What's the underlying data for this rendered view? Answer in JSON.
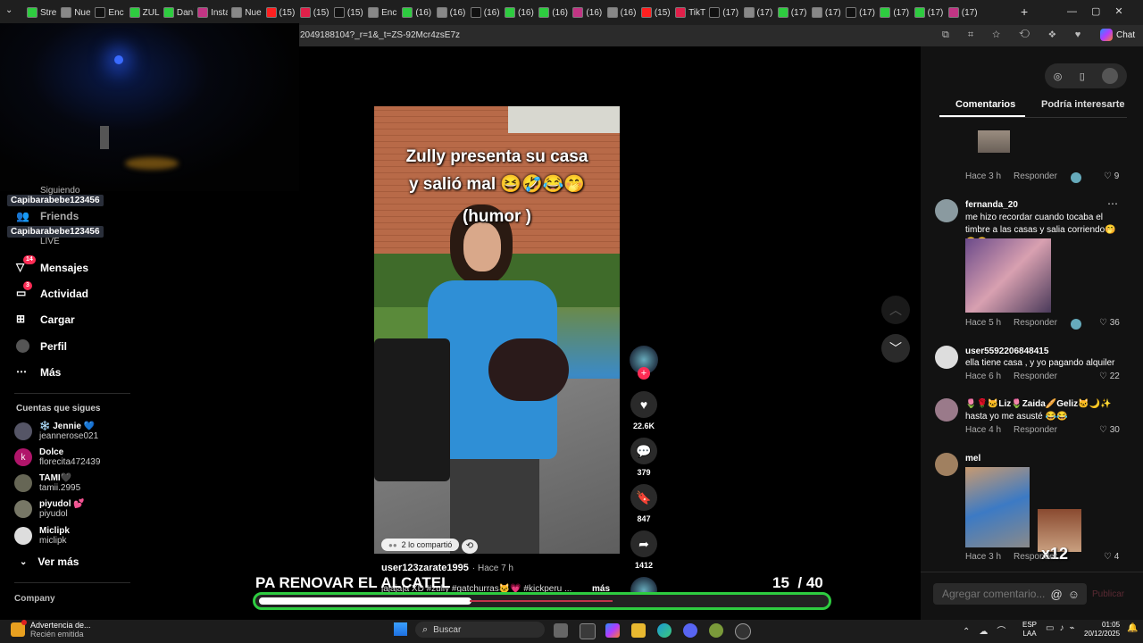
{
  "browser": {
    "tabs": [
      "Stre",
      "Nue",
      "Enc",
      "ZULL",
      "Dani",
      "Insta",
      "Nue",
      "(15)",
      "(15)",
      "(15)",
      "Enc",
      "(16)",
      "(16)",
      "(16)",
      "(16)",
      "(16)",
      "(16)",
      "(16)",
      "(15)",
      "TikT",
      "(17)",
      "(17)",
      "(17)",
      "(17)",
      "(17)",
      "(17)",
      "(17)",
      "(17)"
    ],
    "new_tab": "+",
    "url": "2049188104?_r=1&_t=ZS-92Mcr4zsE7z",
    "chat_label": "Chat"
  },
  "sidebar": {
    "overlay_tags": [
      "Capibarabebe123456",
      "Capibarabebe123456"
    ],
    "cut_top": "Siguiendo",
    "friends": "Friends",
    "live": "LIVE",
    "items": [
      {
        "label": "Mensajes",
        "badge": "14"
      },
      {
        "label": "Actividad",
        "badge": "3"
      },
      {
        "label": "Cargar",
        "badge": ""
      },
      {
        "label": "Perfil",
        "badge": ""
      },
      {
        "label": "Más",
        "badge": ""
      }
    ],
    "following_title": "Cuentas que sigues",
    "following": [
      {
        "name": "❄️ Jennie 💙",
        "user": "jeannerose021",
        "color": "#556"
      },
      {
        "name": "Dolce",
        "user": "florecita472439",
        "color": "#b0156a"
      },
      {
        "name": "TAMI🖤",
        "user": "tamii.2995",
        "color": "#665"
      },
      {
        "name": "piyudol 💕",
        "user": "piyudol",
        "color": "#776"
      },
      {
        "name": "Miclipk",
        "user": "miclipk",
        "color": "#ddd"
      }
    ],
    "see_more": "Ver más",
    "company": "Company"
  },
  "video": {
    "caption_line1": "Zully presenta su casa",
    "caption_line2": "y salió mal 😆🤣😂🤭",
    "caption_line3": "(humor )",
    "shared": "2 lo compartió",
    "author": "user123zarate1995",
    "time": "· Hace 7 h",
    "description": "jajajaja XD #zully #gatchurras🐱💗 #kickperu ...",
    "more": "más"
  },
  "actions": {
    "likes": "22.6K",
    "comments": "379",
    "saves": "847",
    "shares": "1412"
  },
  "comments_panel": {
    "tab_comments": "Comentarios",
    "tab_interesting": "Podría interesarte",
    "reply": "Responder",
    "items": [
      {
        "name": "",
        "text": "",
        "time": "Hace 3 h",
        "likes": "9"
      },
      {
        "name": "fernanda_20",
        "text": "me hizo recordar cuando tocaba el timbre a las casas y salia corriendo🤭😂😂",
        "time": "Hace 5 h",
        "likes": "36"
      },
      {
        "name": "user5592206848415",
        "text": "ella tiene casa , y yo pagando alquiler",
        "time": "Hace 6 h",
        "likes": "22"
      },
      {
        "name": "🌷🌹🐱Liz🌷Zaida🥖Geliz🐱🌙✨",
        "text": "hasta yo me asusté 😂😂",
        "time": "Hace 4 h",
        "likes": "30"
      },
      {
        "name": "mel",
        "text": "",
        "time": "Hace 3 h",
        "likes": "4"
      }
    ],
    "x12": "x12",
    "input_placeholder": "Agregar comentario...",
    "publish": "Publicar"
  },
  "stream_overlay": {
    "title": "PA RENOVAR EL ALCATEL",
    "count": "15",
    "total": "/ 40",
    "progress_fraction": 0.375
  },
  "taskbar": {
    "notification_title": "Advertencia de...",
    "notification_sub": "Recién emitida",
    "search": "Buscar",
    "lang1": "ESP",
    "lang2": "LAA",
    "time": "01:05",
    "date": "20/12/2025"
  }
}
